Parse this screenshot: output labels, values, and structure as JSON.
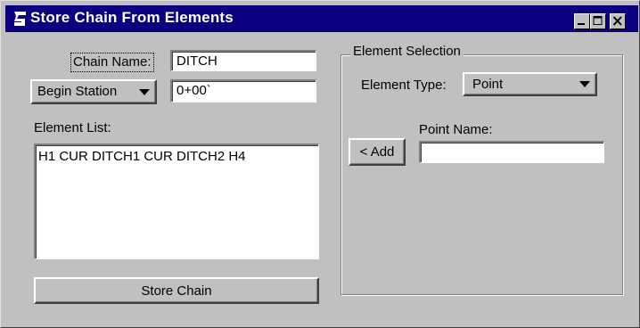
{
  "window": {
    "title": "Store Chain From Elements",
    "title_bar_color": "#0a0080",
    "app_icon": "geopak-g-icon",
    "controls": [
      "minimize-icon",
      "maximize-icon",
      "close-icon"
    ]
  },
  "left_panel": {
    "chain_name_label": "Chain Name:",
    "chain_name_value": "DITCH",
    "begin_station_label": "Begin Station",
    "begin_station_value": "0+00`",
    "element_list_label": "Element List:",
    "element_list_value": "H1 CUR DITCH1 CUR DITCH2 H4",
    "store_chain_label": "Store Chain"
  },
  "element_selection": {
    "group_title": "Element Selection",
    "element_type_label": "Element Type:",
    "element_type_value": "Point",
    "add_button_label": "< Add",
    "point_name_label": "Point Name:",
    "point_name_value": ""
  }
}
